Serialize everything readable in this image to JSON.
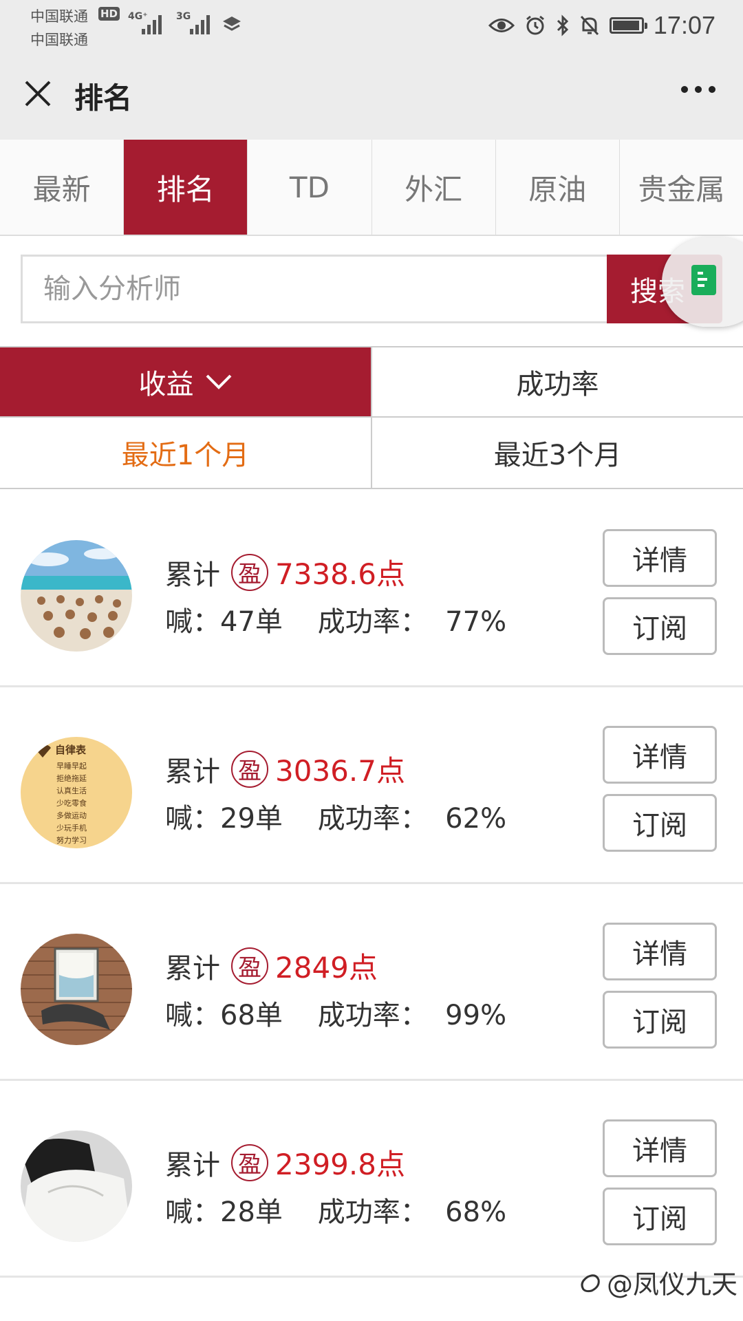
{
  "status_bar": {
    "carrier1": "中国联通",
    "carrier2": "中国联通",
    "hd": "HD",
    "net1": "4G⁺",
    "net2": "3G",
    "time": "17:07"
  },
  "title_bar": {
    "title": "排名"
  },
  "tabs": [
    {
      "label": "最新"
    },
    {
      "label": "排名",
      "active": true
    },
    {
      "label": "TD"
    },
    {
      "label": "外汇"
    },
    {
      "label": "原油"
    },
    {
      "label": "贵金属"
    }
  ],
  "search": {
    "placeholder": "输入分析师",
    "button_label": "搜索"
  },
  "sort_tabs": {
    "profit": "收益",
    "success_rate": "成功率"
  },
  "period_tabs": {
    "recent1": "最近1个月",
    "recent3": "最近3个月"
  },
  "labels": {
    "cumulative": "累计",
    "profit_badge": "盈",
    "details": "详情",
    "subscribe": "订阅"
  },
  "analysts": [
    {
      "profit": "7338.6点",
      "stats": "喊：47单    成功率：  77%"
    },
    {
      "profit": "3036.7点",
      "stats": "喊：29单    成功率：  62%"
    },
    {
      "profit": "2849点",
      "stats": "喊：68单    成功率：  99%"
    },
    {
      "profit": "2399.8点",
      "stats": "喊：28单    成功率：  68%"
    }
  ],
  "avatar_texts": [
    "自律表",
    "早睡早起",
    "拒绝拖延",
    "认真生活",
    "少吃零食",
    "多做运动",
    "少玩手机",
    "努力学习"
  ],
  "watermark": "@凤仪九天",
  "colors": {
    "brand_red": "#a51c30",
    "profit_red": "#d01e24",
    "period_orange": "#e36c14"
  }
}
